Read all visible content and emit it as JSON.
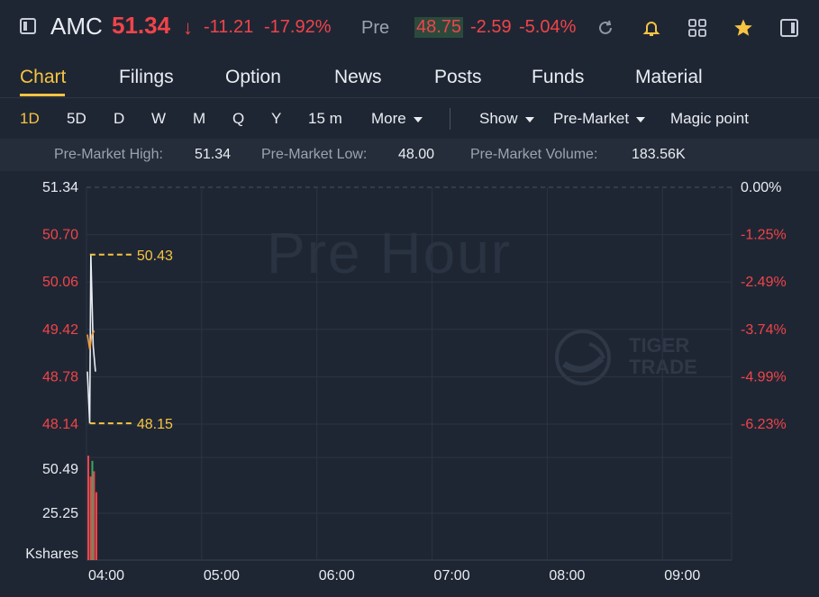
{
  "header": {
    "ticker": "AMC",
    "price": "51.34",
    "arrow": "↓",
    "change": "-11.21",
    "change_pct": "-17.92%",
    "pre_label": "Pre",
    "pre_price": "48.75",
    "pre_change": "-2.59",
    "pre_change_pct": "-5.04%",
    "icons": [
      "panel-icon",
      "refresh-icon",
      "bell-icon",
      "grid-icon",
      "star-icon",
      "sidebar-icon"
    ]
  },
  "tabs": [
    "Chart",
    "Filings",
    "Option",
    "News",
    "Posts",
    "Funds",
    "Material"
  ],
  "periods": [
    "1D",
    "5D",
    "D",
    "W",
    "M",
    "Q",
    "Y",
    "15 m"
  ],
  "toolbar": {
    "more": "More",
    "show": "Show",
    "pre_market": "Pre-Market",
    "magic": "Magic point"
  },
  "stats": {
    "high_label": "Pre-Market High:",
    "high": "51.34",
    "low_label": "Pre-Market Low:",
    "low": "48.00",
    "vol_label": "Pre-Market Volume:",
    "vol": "183.56K"
  },
  "watermark": "Pre Hour",
  "brand": {
    "line1": "TIGER",
    "line2": "TRADE"
  },
  "colors": {
    "accent": "#f6c443",
    "down": "#f0444a",
    "up": "#3aa862",
    "bg": "#1f2633"
  },
  "chart_data": {
    "type": "line",
    "price_axis": [
      "51.34",
      "50.70",
      "50.06",
      "49.42",
      "48.78",
      "48.14"
    ],
    "pct_axis": [
      "0.00%",
      "-1.25%",
      "-2.49%",
      "-3.74%",
      "-4.99%",
      "-6.23%"
    ],
    "volume_axis": [
      "50.49",
      "25.25"
    ],
    "volume_unit": "Kshares",
    "x_ticks": [
      "04:00",
      "05:00",
      "06:00",
      "07:00",
      "08:00",
      "09:00"
    ],
    "ylim": [
      48.14,
      51.34
    ],
    "xlim": [
      0,
      5.6
    ],
    "marker_high": "50.43",
    "marker_low": "48.15",
    "series": [
      {
        "name": "",
        "x": [
          0,
          0.02,
          0.03,
          0.05,
          0.07
        ],
        "y": [
          48.85,
          48.15,
          50.43,
          49.2,
          48.85
        ]
      },
      {
        "name": "",
        "x": [
          0,
          0.02,
          0.04,
          0.06
        ],
        "y": [
          49.35,
          49.15,
          49.35,
          49.4
        ]
      }
    ],
    "volume": [
      {
        "x": 0.0,
        "v": 40
      },
      {
        "x": 0.02,
        "v": 32
      },
      {
        "x": 0.035,
        "v": 38
      },
      {
        "x": 0.05,
        "v": 34
      },
      {
        "x": 0.07,
        "v": 26
      }
    ]
  }
}
